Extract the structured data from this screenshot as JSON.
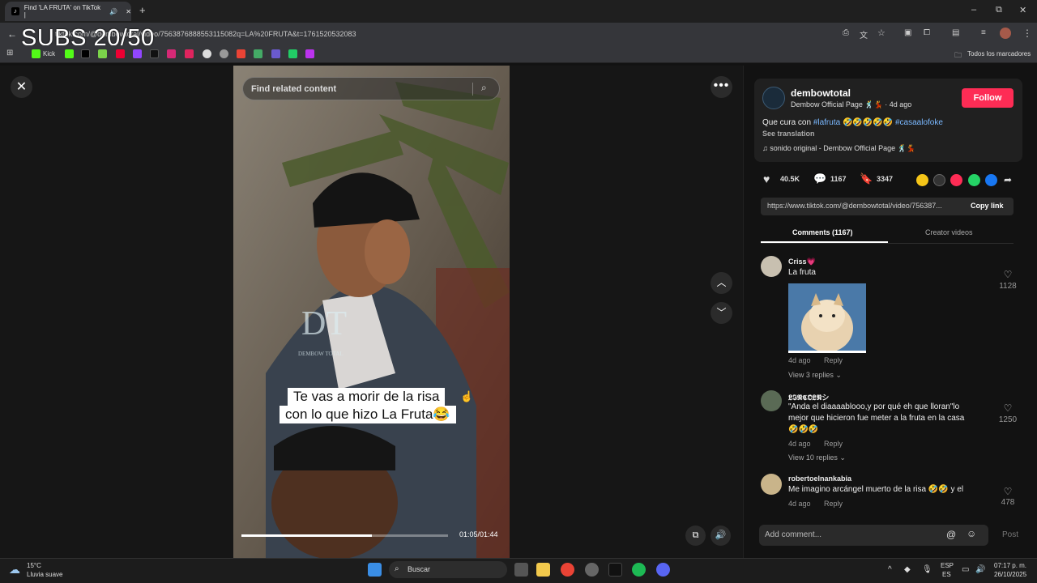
{
  "browser": {
    "tab_title": "Find 'LA FRUTA' on TikTok |",
    "url": "tiktok.com/@dembowtotal/video/7563876888553115082q=LA%20FRUTA&t=1761520532083",
    "bookmark_kick": "Kick",
    "bookmarks_all": "Todos los marcadores"
  },
  "overlay_text": "SUBS 20/50",
  "video": {
    "search_placeholder": "Find related content",
    "caption_line1": "Te vas a morir de la risa",
    "caption_line2": "con lo que hizo La Fruta😂",
    "watermark": "DT",
    "watermark_sub": "DEMBOW TOTAL",
    "progress_fraction": 0.63,
    "timecode": "01:05/01:44"
  },
  "post": {
    "username": "dembowtotal",
    "subname": "Dembow Official Page 🕺💃 · 4d ago",
    "follow_label": "Follow",
    "desc_prefix": "Que cura con ",
    "hashtag1": "#lafruta",
    "desc_emojis": " 🤣🤣🤣🤣🤣 ",
    "hashtag2": "#casaalofoke",
    "see_translation": "See translation",
    "music": "♫  sonido original - Dembow Official Page 🕺💃",
    "likes": "40.5K",
    "comments": "1167",
    "saves": "3347",
    "copy_url": "https://www.tiktok.com/@dembowtotal/video/756387...",
    "copy_link_label": "Copy link"
  },
  "tabs": {
    "comments": "Comments (1167)",
    "creator": "Creator videos"
  },
  "comments": [
    {
      "name": "Criss💗",
      "text": "La fruta",
      "meta": "4d ago",
      "reply": "Reply",
      "replies": "View 3 replies ⌄",
      "likes": "1128"
    },
    {
      "name": "𝕷𝕴𝕹𝕮𝕺𝕷𝕹シ",
      "text_line1": "\"Anda el diaaaablooo,y por qué eh que lloran\"lo",
      "text_line2": "mejor que hicieron fue meter a la fruta en la casa",
      "text_line3": "🤣🤣🤣",
      "meta": "4d ago",
      "reply": "Reply",
      "replies": "View 10 replies ⌄",
      "likes": "1250"
    },
    {
      "name": "robertoelnankabia",
      "text": "Me imagino arcángel muerto de la risa 🤣🤣 y el",
      "meta": "4d ago",
      "reply": "Reply",
      "likes": "478"
    }
  ],
  "comment_input": {
    "placeholder": "Add comment...",
    "post_label": "Post"
  },
  "taskbar": {
    "weather_temp": "15°C",
    "weather_desc": "Lluvia suave",
    "search_label": "Buscar",
    "lang1": "ESP",
    "lang2": "ES",
    "time": "07:17 p. m.",
    "date": "26/10/2025"
  },
  "colors": {
    "accent": "#fe2c55",
    "hashtag": "#7ab8ff"
  }
}
